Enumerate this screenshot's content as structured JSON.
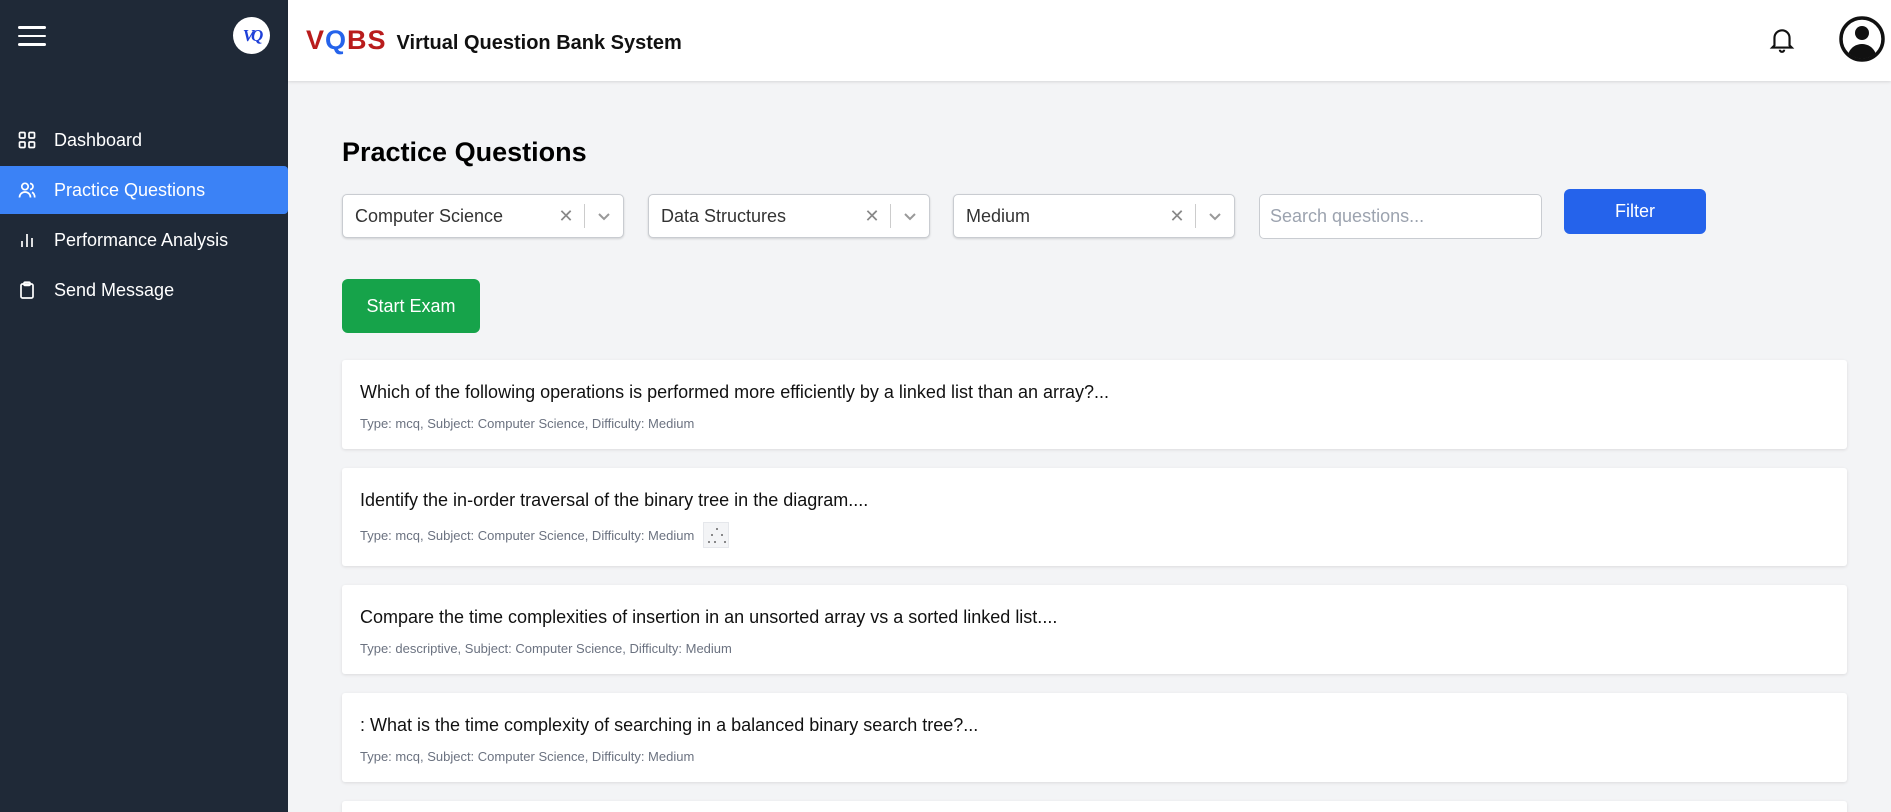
{
  "app": {
    "logo_text": "VQ",
    "brand_v": "V",
    "brand_q": "Q",
    "brand_bs": "BS",
    "title": "Virtual Question Bank System"
  },
  "sidebar": {
    "items": [
      {
        "label": "Dashboard",
        "icon": "grid-icon",
        "active": false
      },
      {
        "label": "Practice Questions",
        "icon": "users-icon",
        "active": true
      },
      {
        "label": "Performance Analysis",
        "icon": "bar-chart-icon",
        "active": false
      },
      {
        "label": "Send Message",
        "icon": "clipboard-icon",
        "active": false
      }
    ]
  },
  "main": {
    "page_title": "Practice Questions",
    "filters": {
      "subject": "Computer Science",
      "topic": "Data Structures",
      "difficulty": "Medium",
      "search_placeholder": "Search questions...",
      "filter_label": "Filter"
    },
    "start_exam_label": "Start Exam",
    "questions": [
      {
        "text": "Which of the following operations is performed more efficiently by a linked list than an array?...",
        "meta": "Type: mcq, Subject: Computer Science, Difficulty: Medium",
        "has_image": false
      },
      {
        "text": "Identify the in-order traversal of the binary tree in the diagram....",
        "meta": "Type: mcq, Subject: Computer Science, Difficulty: Medium",
        "has_image": true
      },
      {
        "text": "Compare the time complexities of insertion in an unsorted array vs a sorted linked list....",
        "meta": "Type: descriptive, Subject: Computer Science, Difficulty: Medium",
        "has_image": false
      },
      {
        "text": ": What is the time complexity of searching in a balanced binary search tree?...",
        "meta": "Type: mcq, Subject: Computer Science, Difficulty: Medium",
        "has_image": false
      }
    ]
  },
  "colors": {
    "sidebar_bg": "#1f2937",
    "active_item": "#3b82f6",
    "filter_button": "#2563eb",
    "start_exam_button": "#16a34a"
  }
}
